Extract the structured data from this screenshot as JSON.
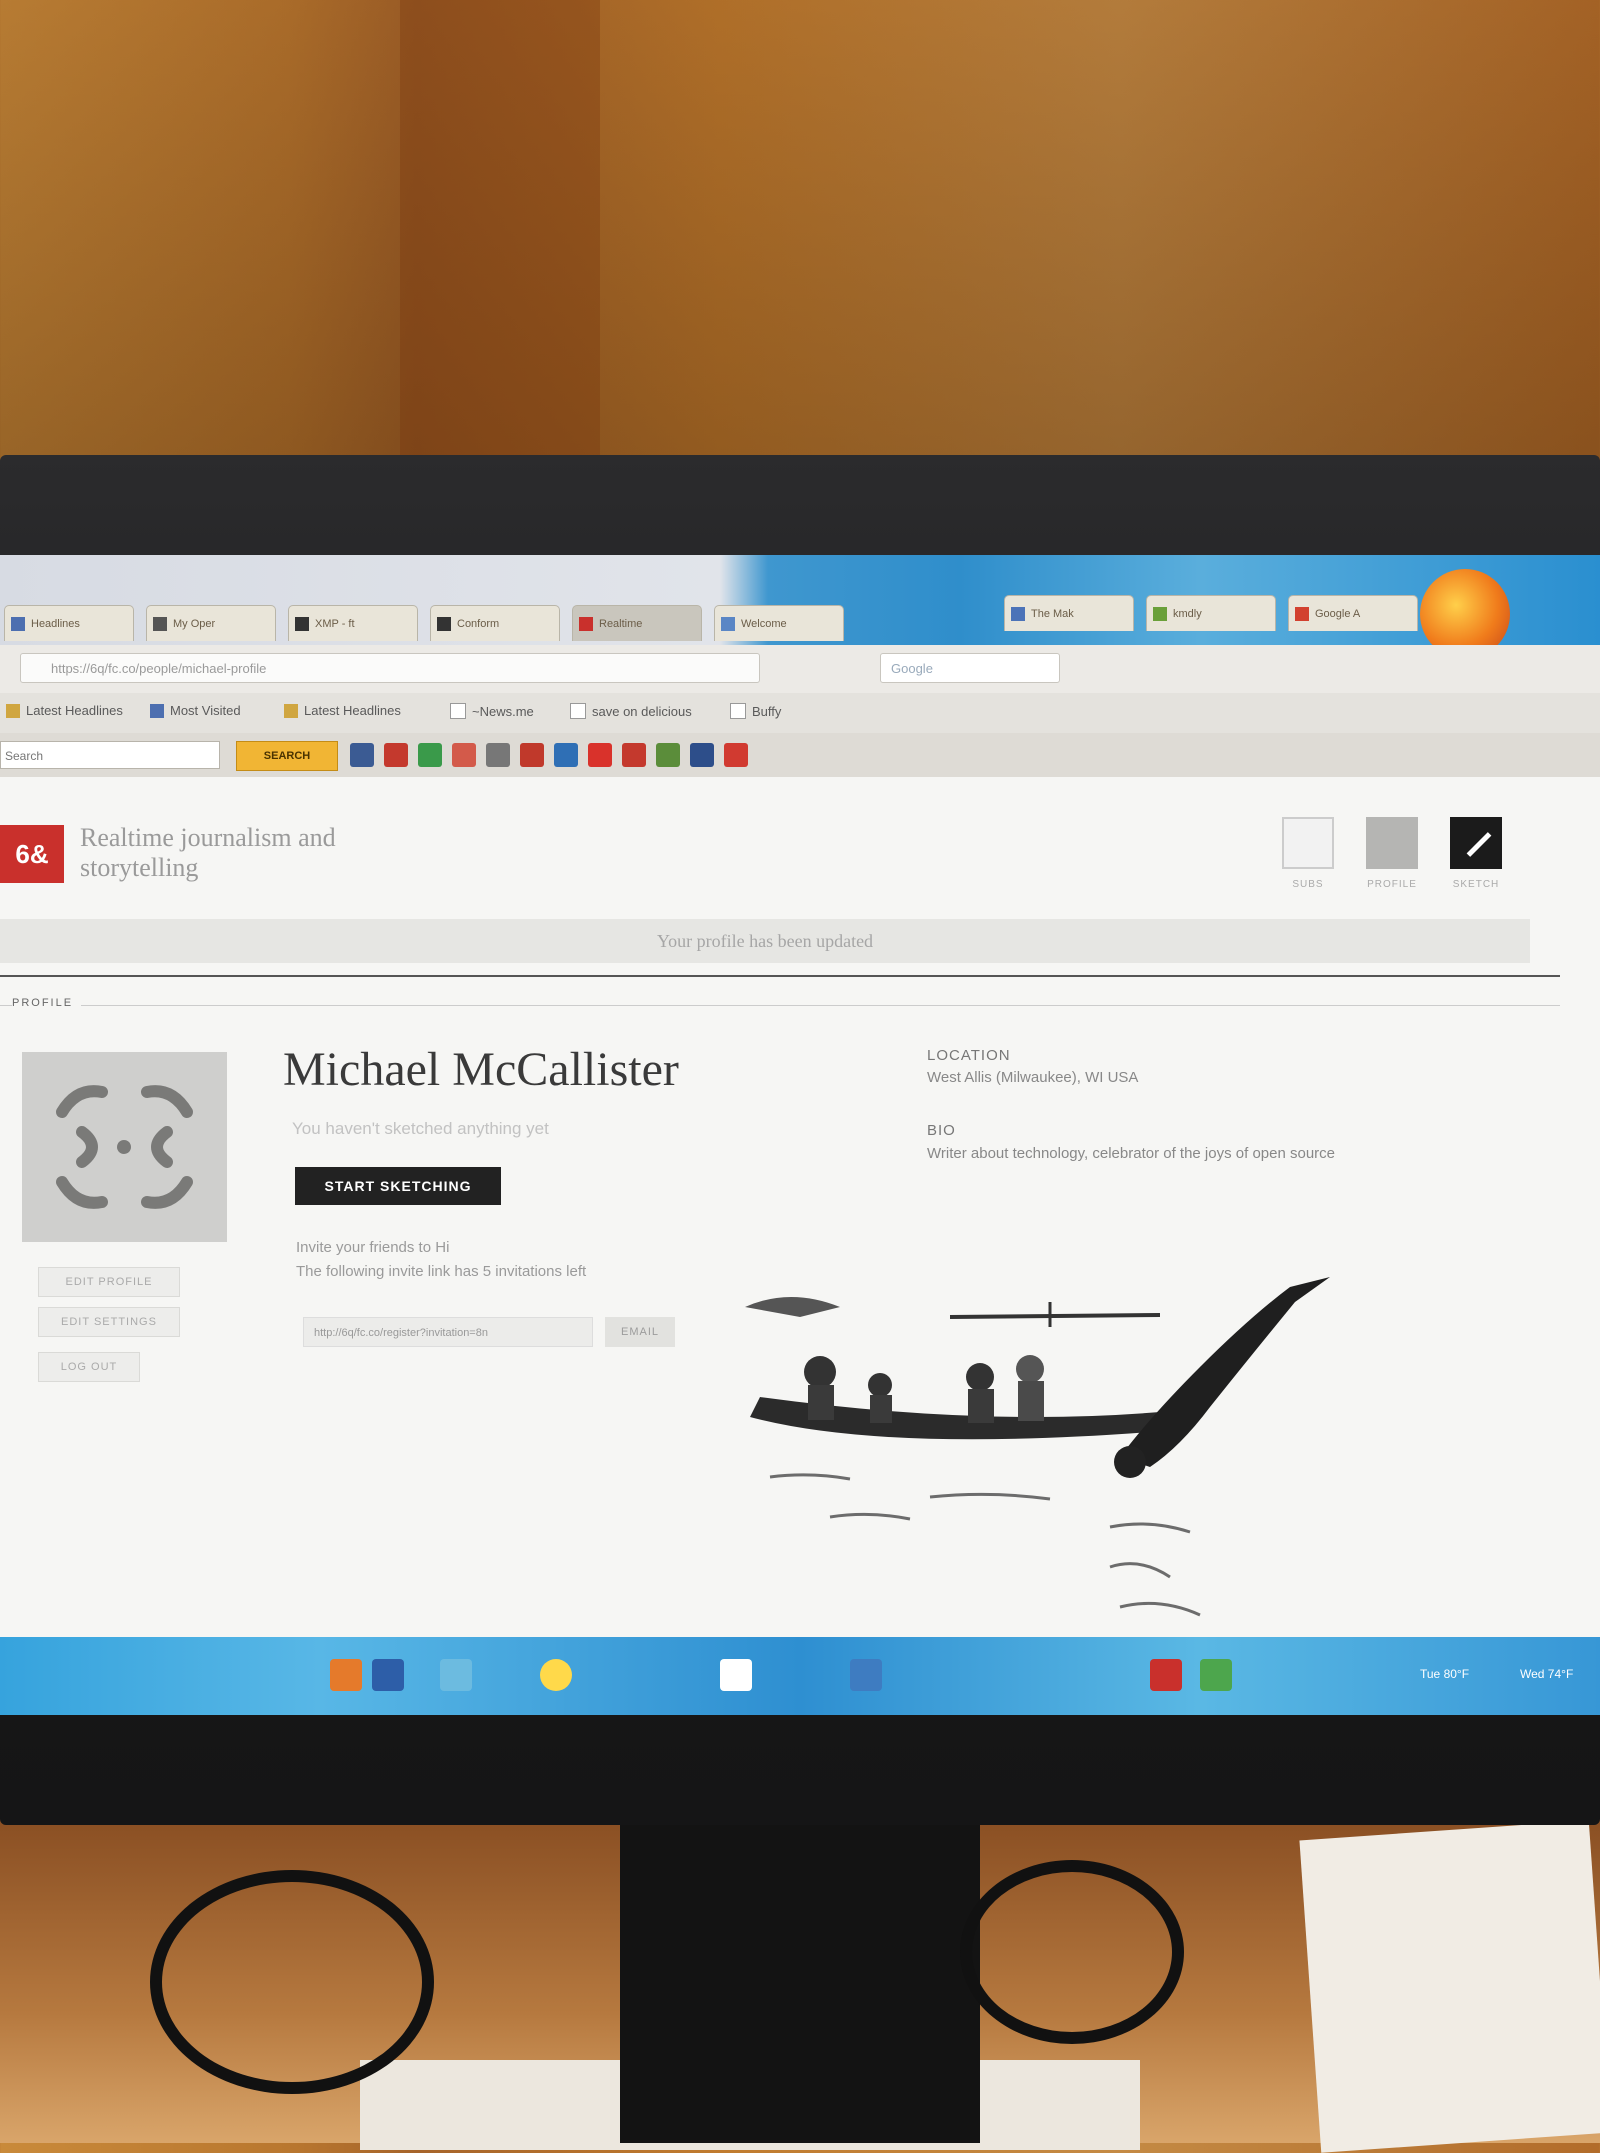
{
  "browser": {
    "tabs": [
      {
        "label": "Headlines"
      },
      {
        "label": "My Oper"
      },
      {
        "label": "XMP - ft"
      },
      {
        "label": "Conform"
      },
      {
        "label": "Realtime"
      },
      {
        "label": "Welcome"
      },
      {
        "label": "The Mak"
      },
      {
        "label": "kmdly"
      },
      {
        "label": "Google A"
      }
    ],
    "url": "https://6q/fc.co/people/michael-profile",
    "search_placeholder": "Google",
    "bookmarks": [
      "Latest Headlines",
      "Most Visited",
      "Latest Headlines",
      "~News.me",
      "save on delicious",
      "Buffy"
    ],
    "toolbar_search_placeholder": "Search",
    "toolbar_search_button": "SEARCH"
  },
  "site": {
    "logo": "6&",
    "tagline": "Realtime journalism and storytelling",
    "nav": [
      {
        "label": "SUBS",
        "icon": "subscriptions-icon"
      },
      {
        "label": "PROFILE",
        "icon": "profile-pattern-icon"
      },
      {
        "label": "SKETCH",
        "icon": "pencil-icon"
      }
    ],
    "notice": "Your profile has been updated",
    "section_label": "PROFILE",
    "sidebar_buttons": [
      "EDIT PROFILE",
      "EDIT SETTINGS",
      "LOG OUT"
    ]
  },
  "profile": {
    "name": "Michael McCallister",
    "sketch_note": "You haven't sketched anything yet",
    "start_button": "START SKETCHING",
    "invite_heading": "Invite your friends to Hi",
    "invite_count_text": "The following invite link has 5 invitations left",
    "invite_link": "http://6q/fc.co/register?invitation=8n",
    "email_button": "EMAIL",
    "location_label": "LOCATION",
    "location_value": "West Allis (Milwaukee), WI USA",
    "bio_label": "BIO",
    "bio_value": "Writer about technology, celebrator of the joys of open source"
  },
  "taskbar": {
    "clock": "Tue 80°F",
    "clock2": "Wed 74°F"
  },
  "colors": {
    "logo_red": "#c9302c",
    "start_button": "#222222",
    "taskbar_blue": "#36a3dd"
  }
}
